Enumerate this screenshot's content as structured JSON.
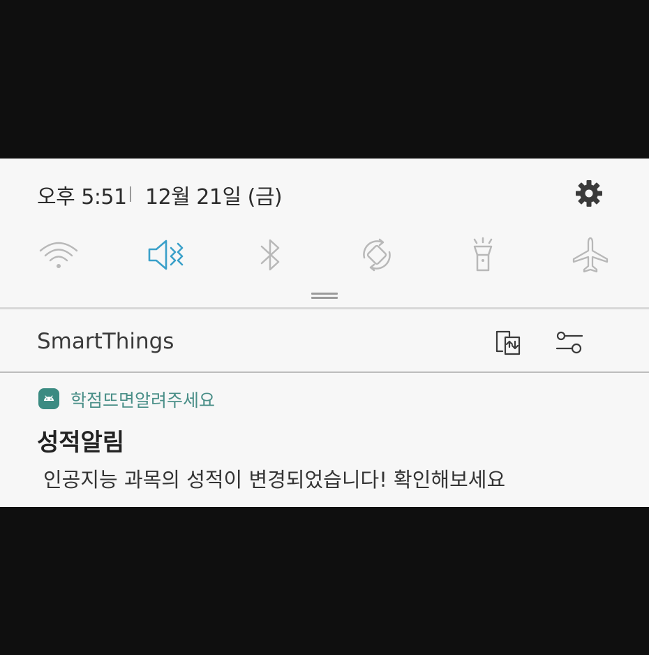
{
  "status": {
    "time": "오후 5:51",
    "date": "12월 21일 (금)"
  },
  "quick_settings": [
    {
      "name": "wifi-icon",
      "active": false
    },
    {
      "name": "mute-vibrate-icon",
      "active": true
    },
    {
      "name": "bluetooth-icon",
      "active": false
    },
    {
      "name": "auto-rotate-icon",
      "active": false
    },
    {
      "name": "flashlight-icon",
      "active": false
    },
    {
      "name": "airplane-mode-icon",
      "active": false
    }
  ],
  "smartthings": {
    "label": "SmartThings"
  },
  "notification": {
    "app_name": "학점뜨면알려주세요",
    "title": "성적알림",
    "body": "인공지능 과목의 성적이 변경되었습니다! 확인해보세요"
  },
  "colors": {
    "active_toggle": "#3aa0c9",
    "inactive_toggle": "#b4b4b4",
    "app_accent": "#3b8b82"
  }
}
